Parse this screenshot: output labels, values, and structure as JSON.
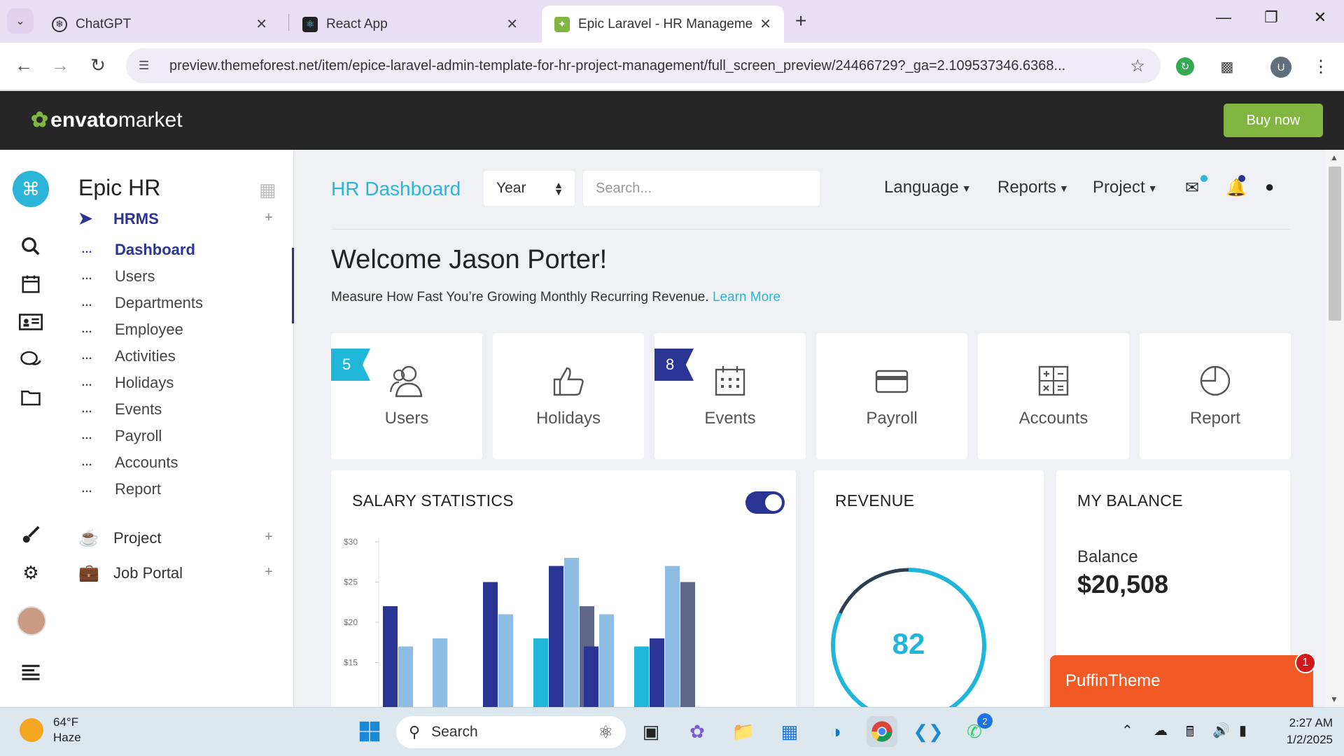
{
  "browser": {
    "tabs": [
      {
        "title": "ChatGPT",
        "icon": "chatgpt-icon"
      },
      {
        "title": "React App",
        "icon": "react-icon"
      },
      {
        "title": "Epic Laravel - HR Management",
        "icon": "envato-icon"
      }
    ],
    "url": "preview.themeforest.net/item/epice-laravel-admin-template-for-hr-project-management/full_screen_preview/24466729?_ga=2.109537346.6368...",
    "profile_initial": "U"
  },
  "envato": {
    "logo_brand": "envato",
    "logo_suffix": "market",
    "buy_label": "Buy now"
  },
  "sidebar": {
    "brand": "Epic HR",
    "section_hrms": "HRMS",
    "items": [
      "Dashboard",
      "Users",
      "Departments",
      "Employee",
      "Activities",
      "Holidays",
      "Events",
      "Payroll",
      "Accounts",
      "Report"
    ],
    "section_project": "Project",
    "section_jobportal": "Job Portal"
  },
  "header": {
    "title": "HR Dashboard",
    "year_select": "Year",
    "search_placeholder": "Search...",
    "nav": [
      "Language",
      "Reports",
      "Project"
    ]
  },
  "welcome": {
    "heading": "Welcome Jason Porter!",
    "subtext": "Measure How Fast You’re Growing Monthly Recurring Revenue.",
    "link": "Learn More"
  },
  "tiles": [
    {
      "label": "Users",
      "badge": "5"
    },
    {
      "label": "Holidays",
      "badge": ""
    },
    {
      "label": "Events",
      "badge": "8"
    },
    {
      "label": "Payroll",
      "badge": ""
    },
    {
      "label": "Accounts",
      "badge": ""
    },
    {
      "label": "Report",
      "badge": ""
    }
  ],
  "cards": {
    "salary_title": "SALARY STATISTICS",
    "revenue_title": "REVENUE",
    "revenue_value": "82",
    "balance_title": "MY BALANCE",
    "balance_label": "Balance",
    "balance_value": "$20,508"
  },
  "chart_data": {
    "type": "bar",
    "title": "SALARY STATISTICS",
    "ytick_labels": [
      "$15",
      "$20",
      "$25",
      "$30"
    ],
    "ylim": [
      15,
      30
    ],
    "group_count": 6,
    "series": [
      {
        "color": "#2a3593",
        "values": [
          22,
          null,
          25,
          27,
          17,
          18
        ]
      },
      {
        "color": "#8dbde3",
        "values": [
          17,
          18,
          21,
          28,
          21,
          27
        ]
      },
      {
        "color": "#1fb6d9",
        "values": [
          null,
          null,
          null,
          18,
          null,
          17
        ]
      },
      {
        "color": "#5f6687",
        "values": [
          null,
          null,
          null,
          22,
          null,
          25
        ]
      }
    ]
  },
  "revenue_gauge": {
    "value": 82,
    "max": 100,
    "track_color": "#2c3e50",
    "fill_color": "#1fb6d9"
  },
  "balance_spark": {
    "color": "#2a3593"
  },
  "widget": {
    "label": "PuffinTheme",
    "badge": "1"
  },
  "taskbar": {
    "temperature": "64°F",
    "condition": "Haze",
    "search_label": "Search",
    "whatsapp_badge": "2",
    "time": "2:27 AM",
    "date": "1/2/2025"
  },
  "colors": {
    "accent": "#2db5d8",
    "primary": "#2a3593",
    "envato_green": "#82b541",
    "puffin_orange": "#f15a24"
  }
}
